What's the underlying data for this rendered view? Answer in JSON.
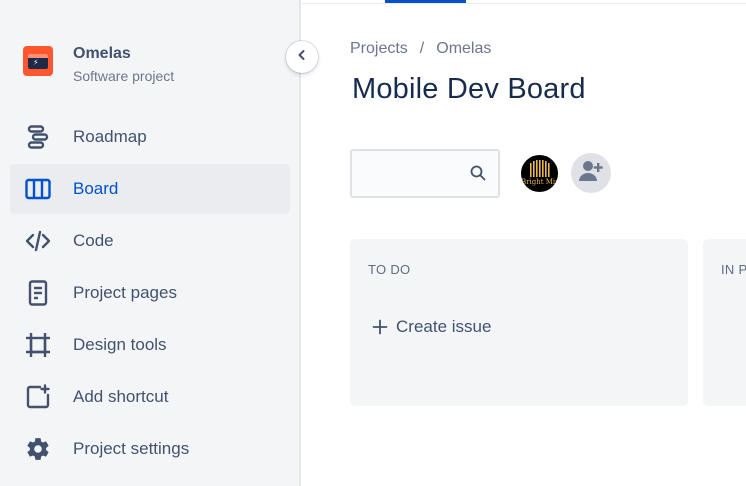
{
  "project": {
    "name": "Omelas",
    "type": "Software project"
  },
  "sidebar": {
    "items": [
      {
        "label": "Roadmap",
        "icon": "roadmap-icon",
        "active": false
      },
      {
        "label": "Board",
        "icon": "board-icon",
        "active": true
      },
      {
        "label": "Code",
        "icon": "code-icon",
        "active": false
      },
      {
        "label": "Project pages",
        "icon": "page-icon",
        "active": false
      },
      {
        "label": "Design tools",
        "icon": "design-tools-icon",
        "active": false
      },
      {
        "label": "Add shortcut",
        "icon": "add-shortcut-icon",
        "active": false
      },
      {
        "label": "Project settings",
        "icon": "gear-icon",
        "active": false
      }
    ]
  },
  "breadcrumb": {
    "items": [
      "Projects",
      "Omelas"
    ],
    "separator": "/"
  },
  "page": {
    "title": "Mobile Dev Board"
  },
  "search": {
    "value": "",
    "placeholder": ""
  },
  "avatars": {
    "user_brand": "Bright Mind"
  },
  "board": {
    "columns": [
      {
        "title": "TO DO",
        "create_label": "Create issue"
      },
      {
        "title": "IN P"
      }
    ]
  },
  "colors": {
    "accent": "#0052cc",
    "sidebar_bg": "#f4f5f7",
    "text": "#42526e",
    "project_avatar": "#ff5630"
  }
}
